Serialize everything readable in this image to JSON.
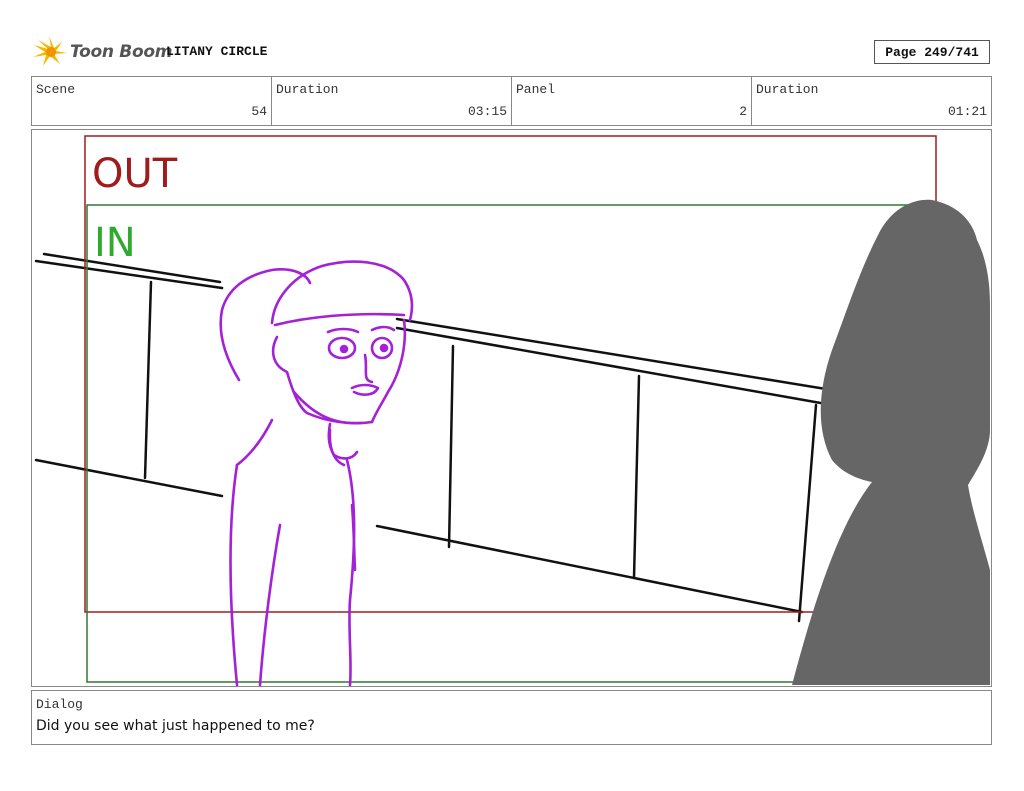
{
  "header": {
    "logo_text": "Toon Boom",
    "logo_icon": "toon-boom-star-icon",
    "project_title": "LITANY CIRCLE",
    "page_label": "Page 249/741"
  },
  "info": {
    "scene_label": "Scene",
    "scene_value": "54",
    "scene_duration_label": "Duration",
    "scene_duration_value": "03:15",
    "panel_label": "Panel",
    "panel_value": "2",
    "panel_duration_label": "Duration",
    "panel_duration_value": "01:21"
  },
  "panel": {
    "out_label": "OUT",
    "in_label": "IN",
    "colors": {
      "out_frame": "#a01c1c",
      "in_frame": "#2f7a2f",
      "character": "#a321d6",
      "silhouette": "#666666"
    }
  },
  "dialog": {
    "label": "Dialog",
    "text": "Did you see what just happened to me?"
  }
}
